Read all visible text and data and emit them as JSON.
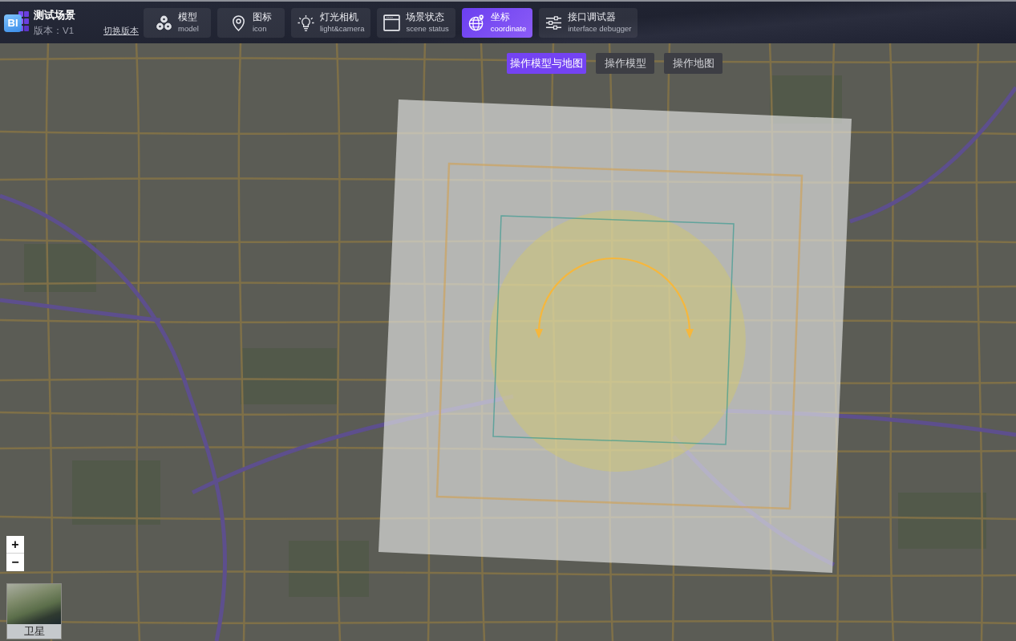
{
  "header": {
    "logo_text": "BI",
    "title": "测试场景",
    "version": "版本：V1",
    "switch_link": "切换版本"
  },
  "nav_tabs": [
    {
      "kind": "model",
      "label": "模型",
      "sublabel": "model",
      "selected": false
    },
    {
      "kind": "icon",
      "label": "图标",
      "sublabel": "icon",
      "selected": false
    },
    {
      "kind": "light",
      "label": "灯光相机",
      "sublabel": "light&camera",
      "selected": false
    },
    {
      "kind": "scene",
      "label": "场景状态",
      "sublabel": "scene status",
      "selected": false
    },
    {
      "kind": "coordinate",
      "label": "坐标",
      "sublabel": "coordinate",
      "selected": true
    },
    {
      "kind": "debugger",
      "label": "接口调试器",
      "sublabel": "interface debugger",
      "selected": false
    }
  ],
  "mode_buttons": [
    {
      "label": "操作模型与地图",
      "selected": true
    },
    {
      "label": "操作模型",
      "selected": false
    },
    {
      "label": "操作地图",
      "selected": false
    }
  ],
  "map": {
    "zoom_buttons": [
      "+",
      "−"
    ],
    "layer_switch": {
      "label": "卫星"
    }
  }
}
